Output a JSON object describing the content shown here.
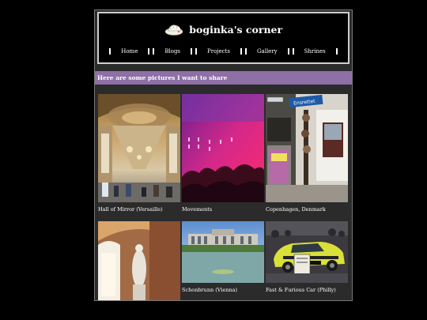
{
  "site": {
    "title": "boginka's corner"
  },
  "nav": {
    "items": [
      "Home",
      "Blogs",
      "Projects",
      "Gallery",
      "Shrines"
    ]
  },
  "banner": {
    "text": "Here are some pictures I want to share"
  },
  "gallery": [
    {
      "caption": "Hall of Mirror (Versaille)"
    },
    {
      "caption": "Movements"
    },
    {
      "caption": "Copenhagen, Denmark"
    },
    {
      "caption": ""
    },
    {
      "caption": "Schonbrunn (Vienna)"
    },
    {
      "caption": "Fast & Furious Car (Philly)"
    }
  ],
  "photo_text": {
    "street_sign": "Enghavevej",
    "street_sign_2": "Ensrettet"
  }
}
